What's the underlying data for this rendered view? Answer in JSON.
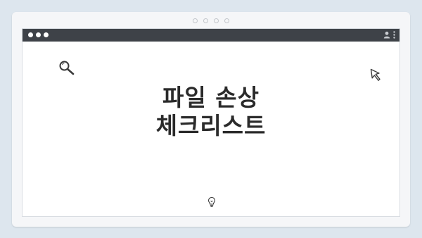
{
  "window": {
    "title_lines": [
      "파일 손상",
      "체크리스트"
    ]
  },
  "icons": {
    "top_left": "search-icon",
    "top_right": "cursor-arrow-icon",
    "bottom": "lightbulb-icon",
    "titlebar_user": "user-icon",
    "titlebar_menu": "kebab-menu-icon"
  },
  "colors": {
    "background": "#dde6ee",
    "titlebar": "#3e4248",
    "text": "#2b2b2b"
  }
}
